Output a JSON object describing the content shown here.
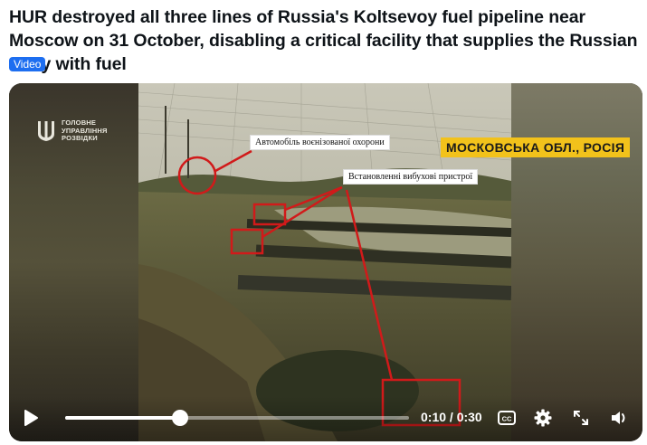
{
  "post": {
    "headline": "HUR destroyed all three lines of Russia's Koltsevoy fuel pipeline near Moscow on 31 October, disabling a critical facility that supplies the Russian army with fuel",
    "badge": "Video"
  },
  "video": {
    "logo_lines": [
      "ГОЛОВНЕ",
      "УПРАВЛІННЯ",
      "РОЗВІДКИ"
    ],
    "location_label": "МОСКОВСЬКА ОБЛ., РОСІЯ",
    "caption_guard": "Автомобіль воєнізованої охорони",
    "caption_devices": "Встановленні вибухові пристрої",
    "progress_fraction": 0.333
  },
  "player": {
    "time_display": "0:10 / 0:30",
    "icons": [
      "play-icon",
      "captions-icon",
      "settings-gear-icon",
      "fullscreen-icon",
      "volume-icon"
    ]
  },
  "colors": {
    "badge": "#1d6ef0",
    "location_bg": "#f2c21b",
    "highlight": "#d11a1a"
  }
}
